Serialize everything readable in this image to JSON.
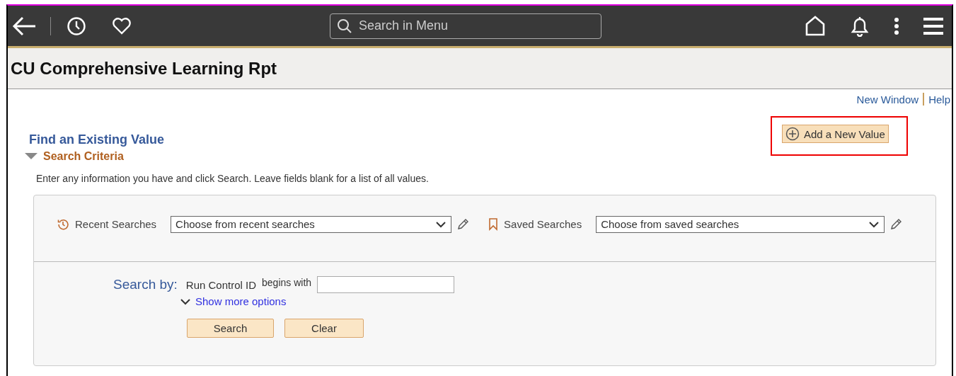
{
  "header": {
    "search": {
      "placeholder": "Search in Menu"
    }
  },
  "page_title": "CU Comprehensive Learning Rpt",
  "links": [
    "New Window",
    "Help"
  ],
  "add_button": {
    "label": "Add a New Value",
    "highlighted": true
  },
  "find_heading": "Find an Existing Value",
  "search_criteria": {
    "label": "Search Criteria",
    "expanded": true
  },
  "instructions": "Enter any information you have and click Search. Leave fields blank for a list of all values.",
  "recent": {
    "label": "Recent Searches",
    "value": "Choose from recent searches"
  },
  "saved": {
    "label": "Saved Searches",
    "value": "Choose from saved searches"
  },
  "search_by": {
    "label": "Search by:",
    "field": "Run Control ID",
    "operator": "begins with",
    "show_more": "Show more options"
  },
  "buttons": [
    "Search",
    "Clear"
  ]
}
